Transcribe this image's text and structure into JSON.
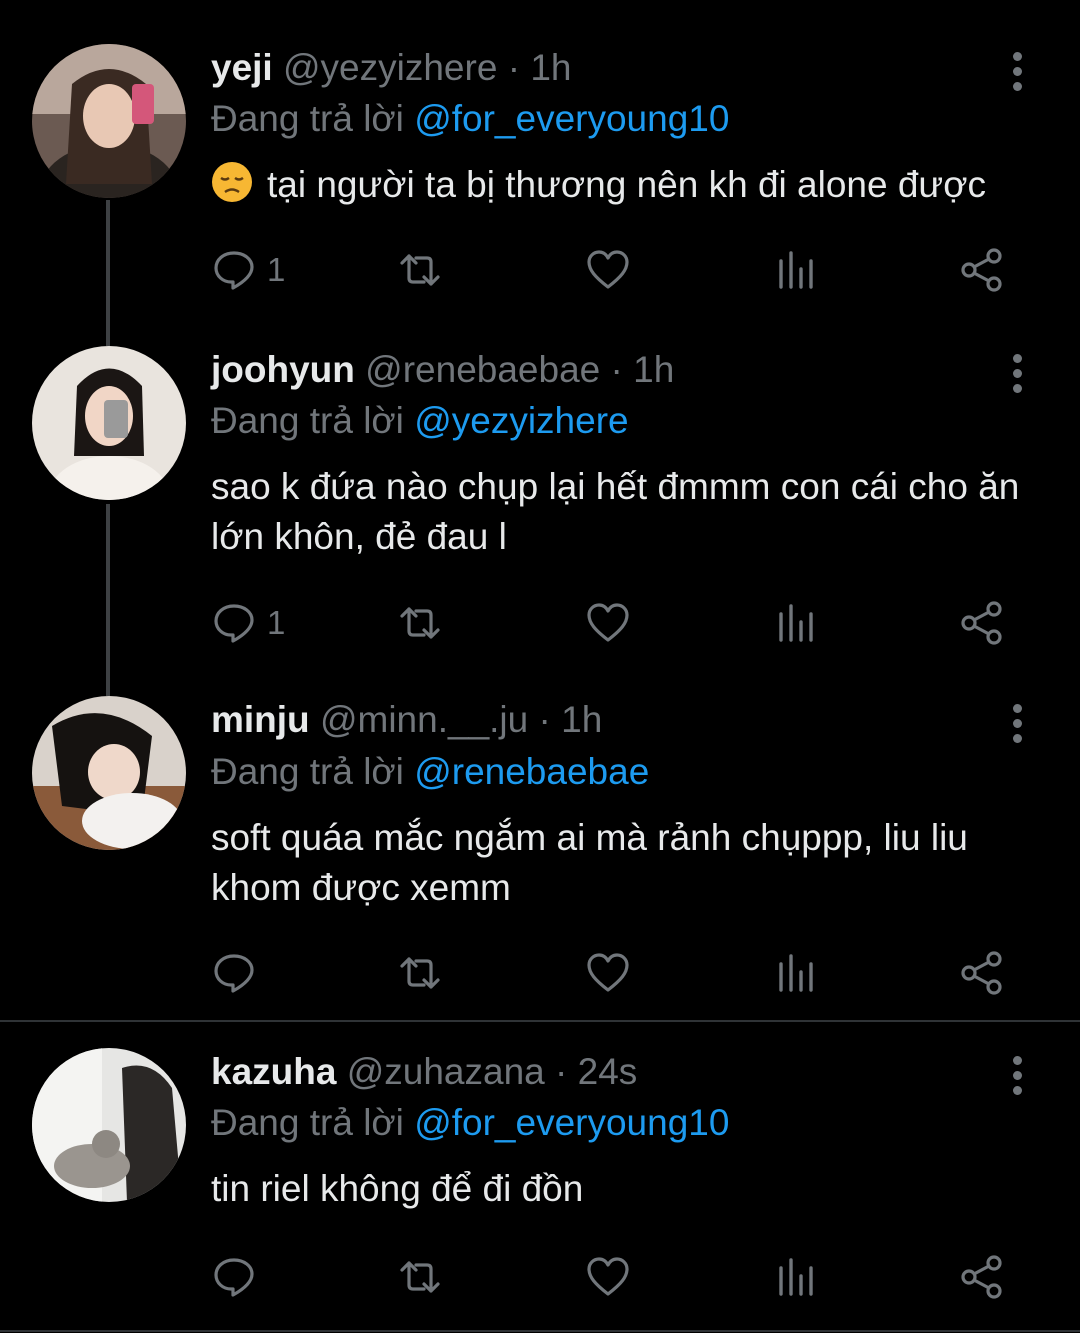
{
  "tweets": [
    {
      "name": "yeji",
      "handle": "@yezyizhere",
      "dot": "·",
      "time": "1h",
      "reply_prefix": "Đang trả lời",
      "reply_to": "@for_everyoung10",
      "text": "tại người ta bị thương nên kh đi alone được",
      "emoji": "disappointed-face",
      "reply_count": "1"
    },
    {
      "name": "joohyun",
      "handle": "@renebaebae",
      "dot": "·",
      "time": "1h",
      "reply_prefix": "Đang trả lời",
      "reply_to": "@yezyizhere",
      "text": "sao k đứa nào chụp lại hết đmmm con cái cho ăn lớn khôn, đẻ đau l",
      "reply_count": "1"
    },
    {
      "name": "minju",
      "handle": "@minn.__.ju",
      "dot": "·",
      "time": "1h",
      "reply_prefix": "Đang trả lời",
      "reply_to": "@renebaebae",
      "text": "soft quáa mắc ngắm ai mà rảnh chụppp, liu liu khom được xemm",
      "reply_count": ""
    },
    {
      "name": "kazuha",
      "handle": "@zuhazana",
      "dot": "·",
      "time": "24s",
      "reply_prefix": "Đang trả lời",
      "reply_to": "@for_everyoung10",
      "text": "tin riel không để đi đồn",
      "reply_count": ""
    }
  ],
  "colors": {
    "background": "#000000",
    "text": "#e7e9ea",
    "muted": "#71767b",
    "mention": "#1d9bf0",
    "thread_line": "#3e4144"
  },
  "icons": [
    "reply-icon",
    "retweet-icon",
    "like-icon",
    "views-icon",
    "share-icon",
    "more-icon"
  ]
}
